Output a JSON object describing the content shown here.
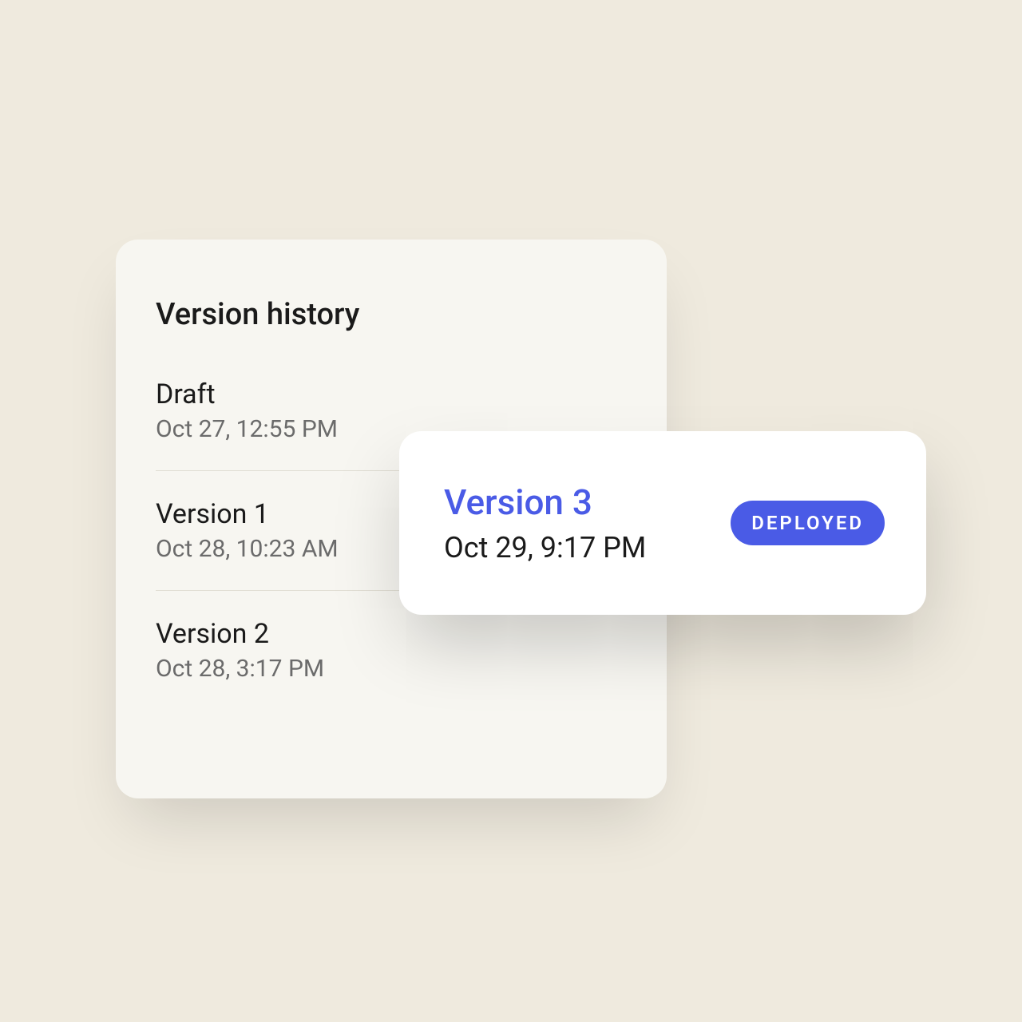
{
  "history": {
    "title": "Version history",
    "items": [
      {
        "label": "Draft",
        "date": "Oct 27, 12:55 PM"
      },
      {
        "label": "Version 1",
        "date": "Oct 28, 10:23 AM"
      },
      {
        "label": "Version 2",
        "date": "Oct 28, 3:17 PM"
      }
    ]
  },
  "featured": {
    "label": "Version 3",
    "date": "Oct 29, 9:17 PM",
    "badge": "DEPLOYED"
  },
  "colors": {
    "accent": "#4a5be6",
    "page_bg": "#efeade",
    "card_bg": "#f7f6f1"
  }
}
